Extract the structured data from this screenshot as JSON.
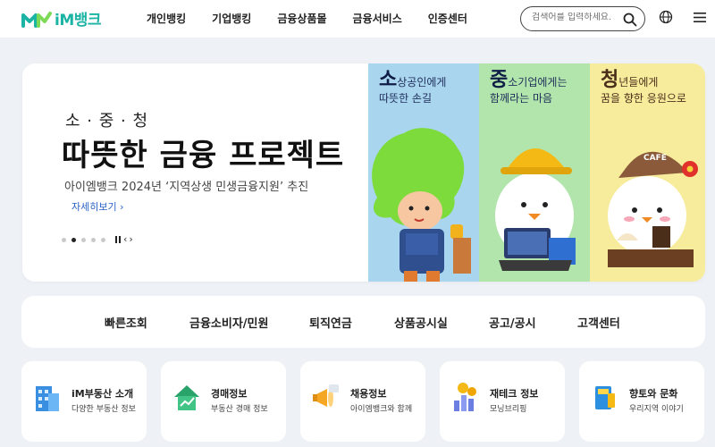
{
  "header": {
    "logo_text": "iM뱅크",
    "nav": [
      {
        "label": "개인뱅킹"
      },
      {
        "label": "기업뱅킹"
      },
      {
        "label": "금융상품몰"
      },
      {
        "label": "금융서비스"
      },
      {
        "label": "인증센터"
      }
    ],
    "search_placeholder": "검색어를 입력하세요.",
    "icons": {
      "search": "search-icon",
      "language": "globe-icon",
      "menu": "hamburger-menu-icon"
    }
  },
  "hero": {
    "subtitle": "소 · 중 · 청",
    "title": "따뜻한 금융 프로젝트",
    "description": "아이엠뱅크 2024년 ‘지역상생 민생금융지원’ 추진",
    "link_label": "자세히보기 ›",
    "pager": {
      "total": 5,
      "active": 2
    },
    "panels": [
      {
        "big": "소",
        "line1_rest": "상공인에게",
        "line2": "따뜻한 손길",
        "color": "#a9d5ee"
      },
      {
        "big": "중",
        "line1_rest": "소기업에게는",
        "line2": "함께라는 마음",
        "color": "#b1e5ab"
      },
      {
        "big": "청",
        "line1_rest": "년들에게",
        "line2": "꿈을 향한 응원으로",
        "color": "#f7ec9c"
      }
    ],
    "cafe_sign": "CAFE"
  },
  "quick_menu": [
    {
      "label": "빠른조회"
    },
    {
      "label": "금융소비자/민원"
    },
    {
      "label": "퇴직연금"
    },
    {
      "label": "상품공시실"
    },
    {
      "label": "공고/공시"
    },
    {
      "label": "고객센터"
    }
  ],
  "cards": [
    {
      "title": "iM부동산 소개",
      "desc": "다양한 부동산 정보",
      "icon": "building-icon"
    },
    {
      "title": "경매정보",
      "desc": "부동산 경매 정보",
      "icon": "house-chart-icon"
    },
    {
      "title": "채용정보",
      "desc": "아이엠뱅크와 함께",
      "icon": "megaphone-icon"
    },
    {
      "title": "재테크 정보",
      "desc": "모닝브리핑",
      "icon": "coins-chart-icon"
    },
    {
      "title": "향토와 문화",
      "desc": "우리지역 이야기",
      "icon": "book-icon"
    }
  ],
  "colors": {
    "brand": "#1bb3a4",
    "link": "#2a62c7"
  }
}
